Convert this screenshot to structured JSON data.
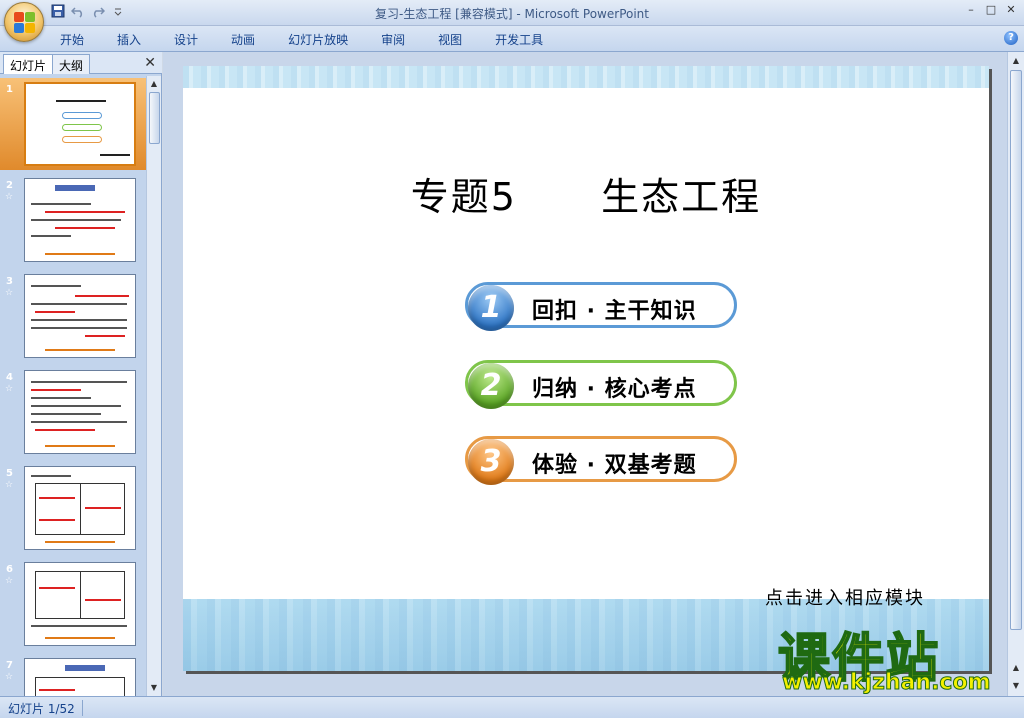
{
  "window": {
    "title": "复习-生态工程 [兼容模式] - Microsoft PowerPoint",
    "controls": [
      "–",
      "□",
      "✕"
    ]
  },
  "ribbon": {
    "tabs": [
      "开始",
      "插入",
      "设计",
      "动画",
      "幻灯片放映",
      "审阅",
      "视图",
      "开发工具"
    ],
    "help": "?"
  },
  "left_pane": {
    "tabs": [
      "幻灯片",
      "大纲"
    ],
    "close": "✕",
    "thumbnails": [
      {
        "num": "1",
        "star": ""
      },
      {
        "num": "2",
        "star": "☆"
      },
      {
        "num": "3",
        "star": "☆"
      },
      {
        "num": "4",
        "star": "☆"
      },
      {
        "num": "5",
        "star": "☆"
      },
      {
        "num": "6",
        "star": "☆"
      },
      {
        "num": "7",
        "star": "☆"
      }
    ]
  },
  "slide": {
    "title_a": "专题5",
    "title_b": "生态工程",
    "modules": [
      {
        "num": "1",
        "label": "回扣 · 主干知识"
      },
      {
        "num": "2",
        "label": "归纳 · 核心考点"
      },
      {
        "num": "3",
        "label": "体验 · 双基考题"
      }
    ],
    "hint": "点击进入相应模块"
  },
  "status": {
    "slide_info": "幻灯片 1/52"
  },
  "watermark": {
    "cn": "课件站",
    "url": "www.kjzhan.com"
  },
  "colors": {
    "accent_blue": "#2d74c4",
    "accent_green": "#5aa524",
    "accent_orange": "#e07a17"
  }
}
